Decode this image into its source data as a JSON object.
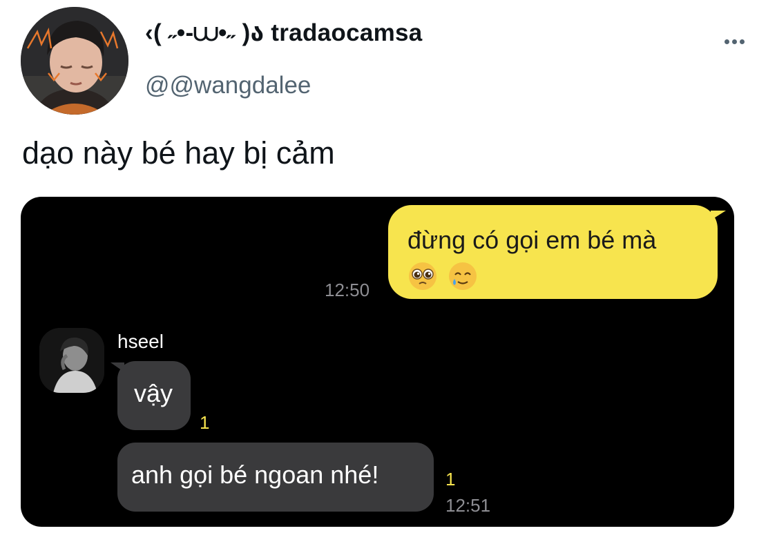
{
  "tweet": {
    "display_name": "‹( ˶•-⩊•˶ )ა tradaocamsa",
    "handle": "@@wangdalee",
    "text": "dạo này bé hay bị cảm"
  },
  "chat": {
    "outgoing": {
      "text": "đừng có gọi em bé mà",
      "emojis": [
        "pleading-face-icon",
        "smiling-face-with-tear-icon"
      ],
      "time": "12:50"
    },
    "sender_name": "hseel",
    "incoming": [
      {
        "text": "vậy",
        "unread": "1"
      },
      {
        "text": "anh gọi bé ngoan nhé!",
        "unread": "1",
        "time": "12:51"
      }
    ]
  },
  "colors": {
    "outgoing_bubble": "#f7e44e",
    "incoming_bubble": "#3a3a3c",
    "chat_background": "#000000",
    "handle_gray": "#536471"
  }
}
